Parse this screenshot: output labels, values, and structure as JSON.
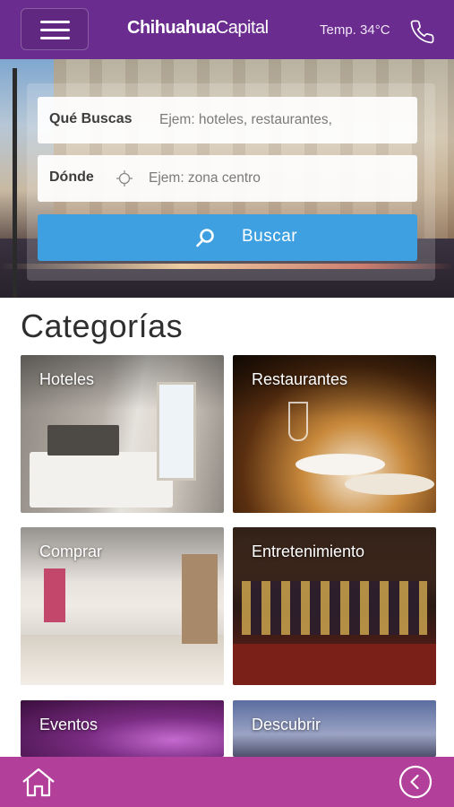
{
  "header": {
    "menu_icon": "hamburger-menu-icon",
    "brand_bold": "Chihuahua",
    "brand_light": "Capital",
    "temperature": "Temp. 34°C",
    "phone_icon": "phone-icon",
    "color": "#6a2c8e"
  },
  "search": {
    "what_label": "Qué Buscas",
    "what_placeholder": "Ejem: hoteles, restaurantes,",
    "where_label": "Dónde",
    "where_placeholder": "Ejem: zona centro",
    "location_icon": "crosshair-icon",
    "button_label": "Buscar",
    "button_icon": "search-icon",
    "button_color": "#3ea0e0"
  },
  "categories": {
    "title": "Categorías",
    "items": [
      {
        "label": "Hoteles"
      },
      {
        "label": "Restaurantes"
      },
      {
        "label": "Comprar"
      },
      {
        "label": "Entretenimiento"
      },
      {
        "label": "Eventos"
      },
      {
        "label": "Descubrir"
      }
    ]
  },
  "footer": {
    "home_icon": "home-icon",
    "back_icon": "chevron-left-circle-icon",
    "color": "#b23f9a"
  }
}
